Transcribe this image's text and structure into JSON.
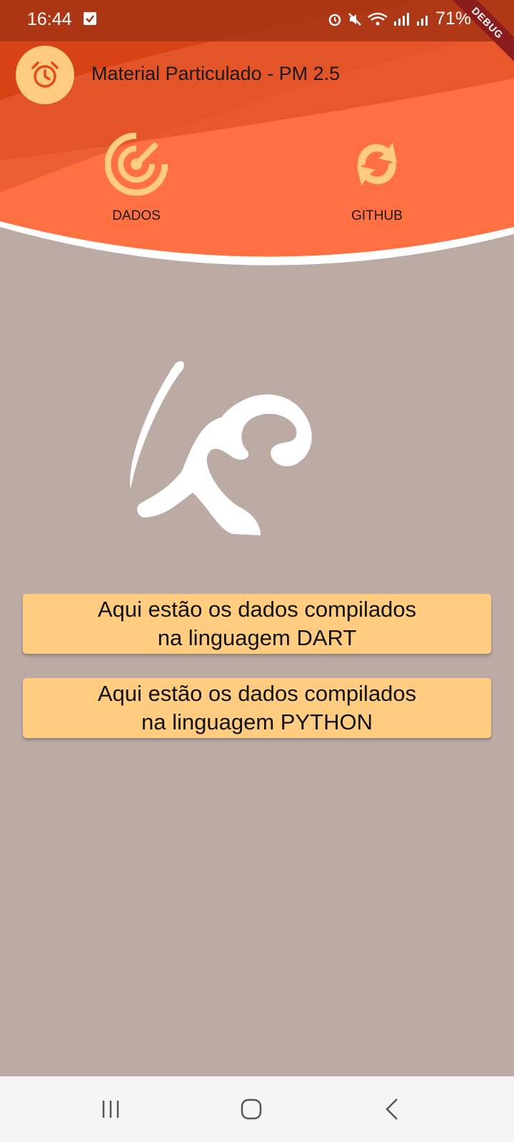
{
  "status_bar": {
    "time": "16:44",
    "battery": "71%",
    "debug_banner": "DEBUG"
  },
  "app_bar": {
    "title": "Material Particulado - PM 2.5",
    "avatar_icon": "alarm-clock-icon"
  },
  "nav": {
    "items": [
      {
        "label": "DADOS",
        "icon": "radar-icon"
      },
      {
        "label": "GITHUB",
        "icon": "sync-icon"
      }
    ]
  },
  "buttons": {
    "dart": {
      "line1": "Aqui estão os dados compilados",
      "line2": "na linguagem DART"
    },
    "python": {
      "line1": "Aqui estão os dados compilados",
      "line2": "na linguagem PYTHON"
    }
  },
  "colors": {
    "header_orange": "#ff7043",
    "header_dark": "#d84315",
    "accent": "#ffcc80",
    "background": "#bcaaa4"
  },
  "system_nav": {
    "icons": [
      "recent-apps-icon",
      "home-icon",
      "back-icon"
    ]
  }
}
